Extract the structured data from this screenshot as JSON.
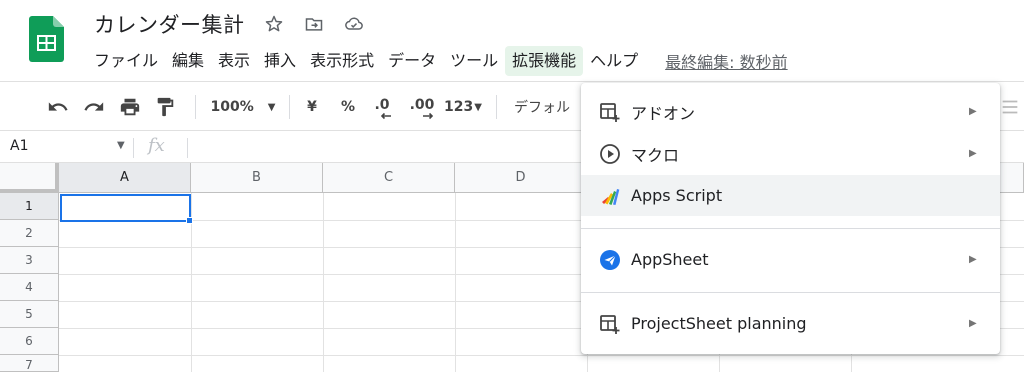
{
  "doc": {
    "title": "カレンダー集計",
    "star_icon": "star-icon",
    "move_icon": "folder-move-icon",
    "saved_icon": "cloud-saved-icon"
  },
  "menubar": {
    "items": [
      "ファイル",
      "編集",
      "表示",
      "挿入",
      "表示形式",
      "データ",
      "ツール",
      "拡張機能",
      "ヘルプ"
    ],
    "active": "拡張機能",
    "last_edit": "最終編集: 数秒前"
  },
  "toolbar": {
    "zoom": "100%",
    "currency": "¥",
    "percent": "%",
    "dec_decrease": ".0",
    "dec_increase": ".00",
    "more_formats": "123",
    "font": "デフォル"
  },
  "formula": {
    "cell_ref": "A1",
    "fx": "fx"
  },
  "grid": {
    "columns": [
      "A",
      "B",
      "C",
      "D"
    ],
    "rows": [
      "1",
      "2",
      "3",
      "4",
      "5",
      "6",
      "7"
    ],
    "selected_cell": "A1"
  },
  "extensions_menu": {
    "items": [
      {
        "label": "アドオン",
        "icon": "addon-icon",
        "submenu": true
      },
      {
        "label": "マクロ",
        "icon": "macro-play-icon",
        "submenu": true
      },
      {
        "label": "Apps Script",
        "icon": "apps-script-icon",
        "submenu": false
      },
      {
        "label": "AppSheet",
        "icon": "appsheet-icon",
        "submenu": true
      },
      {
        "label": "ProjectSheet planning",
        "icon": "projectsheet-icon",
        "submenu": true
      }
    ]
  },
  "colors": {
    "accent": "#1a73e8",
    "sheets_green": "#0f9d58",
    "menu_active_bg": "#e6f4ea",
    "hover_bg": "#f1f3f4"
  }
}
